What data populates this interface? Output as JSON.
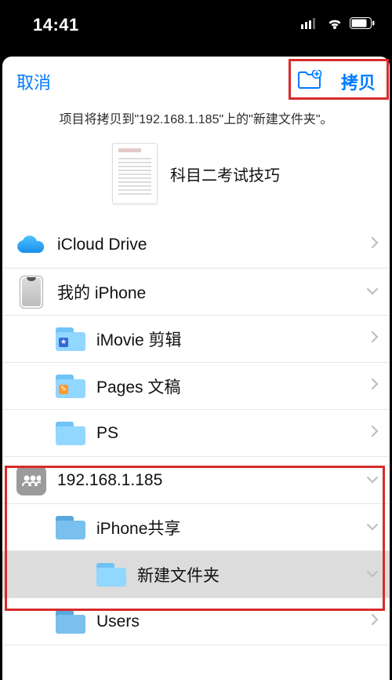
{
  "statusbar": {
    "time": "14:41"
  },
  "nav": {
    "cancel": "取消",
    "copy": "拷贝"
  },
  "description": "项目将拷贝到\"192.168.1.185\"上的\"新建文件夹\"。",
  "preview": {
    "filename": "科目二考试技巧"
  },
  "locations": [
    {
      "id": "icloud",
      "label": "iCloud Drive",
      "icon": "icloud",
      "level": 0,
      "chevron": "right"
    },
    {
      "id": "myiphone",
      "label": "我的 iPhone",
      "icon": "phone",
      "level": 0,
      "chevron": "down"
    },
    {
      "id": "imovie",
      "label": "iMovie 剪辑",
      "icon": "folder-star",
      "level": 1,
      "chevron": "right"
    },
    {
      "id": "pages",
      "label": "Pages 文稿",
      "icon": "folder-pen",
      "level": 1,
      "chevron": "right"
    },
    {
      "id": "ps",
      "label": "PS",
      "icon": "folder",
      "level": 1,
      "chevron": "right"
    },
    {
      "id": "server",
      "label": "192.168.1.185",
      "icon": "server",
      "level": 0,
      "chevron": "down"
    },
    {
      "id": "iphone-share",
      "label": "iPhone共享",
      "icon": "folder-dark",
      "level": 1,
      "chevron": "down"
    },
    {
      "id": "newfolder",
      "label": "新建文件夹",
      "icon": "folder",
      "level": 2,
      "chevron": "down",
      "selected": true
    },
    {
      "id": "users",
      "label": "Users",
      "icon": "folder-dark",
      "level": 1,
      "chevron": "right"
    }
  ],
  "icons": {
    "folder-star-badge": "★",
    "folder-pen-badge": "✎"
  }
}
